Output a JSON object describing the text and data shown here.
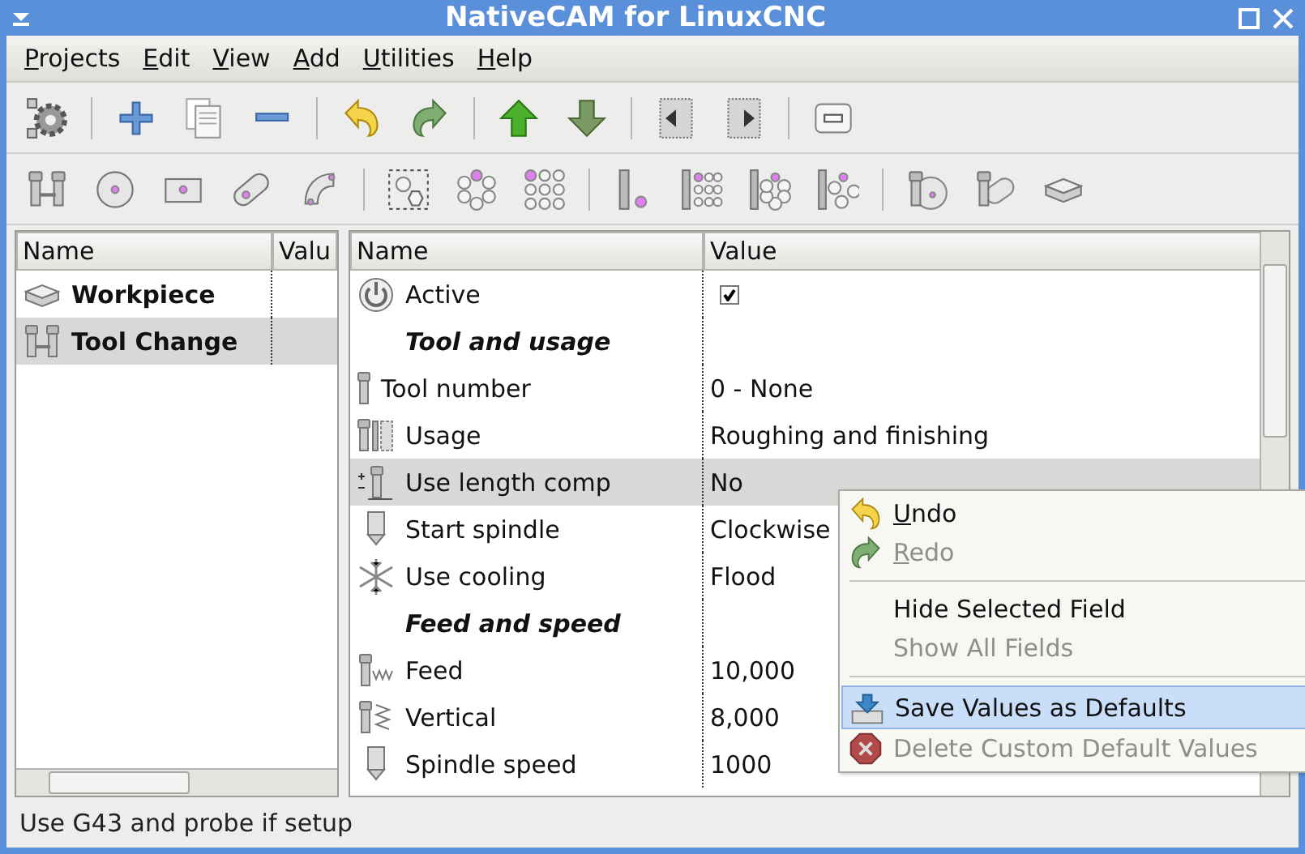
{
  "window": {
    "title": "NativeCAM for LinuxCNC"
  },
  "menu": [
    "Projects",
    "Edit",
    "View",
    "Add",
    "Utilities",
    "Help"
  ],
  "project_tree": {
    "columns": [
      "Name",
      "Valu"
    ],
    "items": [
      {
        "name": "Workpiece",
        "selected": false
      },
      {
        "name": "Tool Change",
        "selected": true
      }
    ]
  },
  "properties": {
    "columns": [
      "Name",
      "Value"
    ],
    "rows": [
      {
        "kind": "checkbox",
        "name": "Active",
        "checked": true,
        "selected": false
      },
      {
        "kind": "section",
        "name": "Tool and usage"
      },
      {
        "kind": "field",
        "name": "Tool number",
        "value": "0 - None",
        "selected": false
      },
      {
        "kind": "field",
        "name": "Usage",
        "value": "Roughing and finishing",
        "selected": false
      },
      {
        "kind": "field",
        "name": "Use length comp",
        "value": "No",
        "selected": true
      },
      {
        "kind": "field",
        "name": "Start spindle",
        "value": "Clockwise",
        "selected": false
      },
      {
        "kind": "field",
        "name": "Use cooling",
        "value": "Flood",
        "selected": false
      },
      {
        "kind": "section",
        "name": "Feed and speed"
      },
      {
        "kind": "field",
        "name": "Feed",
        "value": "10,000",
        "selected": false
      },
      {
        "kind": "field",
        "name": "Vertical",
        "value": "8,000",
        "selected": false
      },
      {
        "kind": "field",
        "name": "Spindle speed",
        "value": "1000",
        "selected": false
      }
    ]
  },
  "context_menu": [
    {
      "kind": "item",
      "label": "Undo",
      "disabled": false,
      "selected": false
    },
    {
      "kind": "item",
      "label": "Redo",
      "disabled": true,
      "selected": false
    },
    {
      "kind": "separator"
    },
    {
      "kind": "item",
      "label": "Hide Selected Field",
      "disabled": false,
      "selected": false
    },
    {
      "kind": "item",
      "label": "Show All Fields",
      "disabled": true,
      "selected": false
    },
    {
      "kind": "separator"
    },
    {
      "kind": "item",
      "label": "Save Values as Defaults",
      "disabled": false,
      "selected": true
    },
    {
      "kind": "item",
      "label": "Delete Custom Default Values",
      "disabled": true,
      "selected": false
    }
  ],
  "status_bar": "Use G43 and probe if setup"
}
